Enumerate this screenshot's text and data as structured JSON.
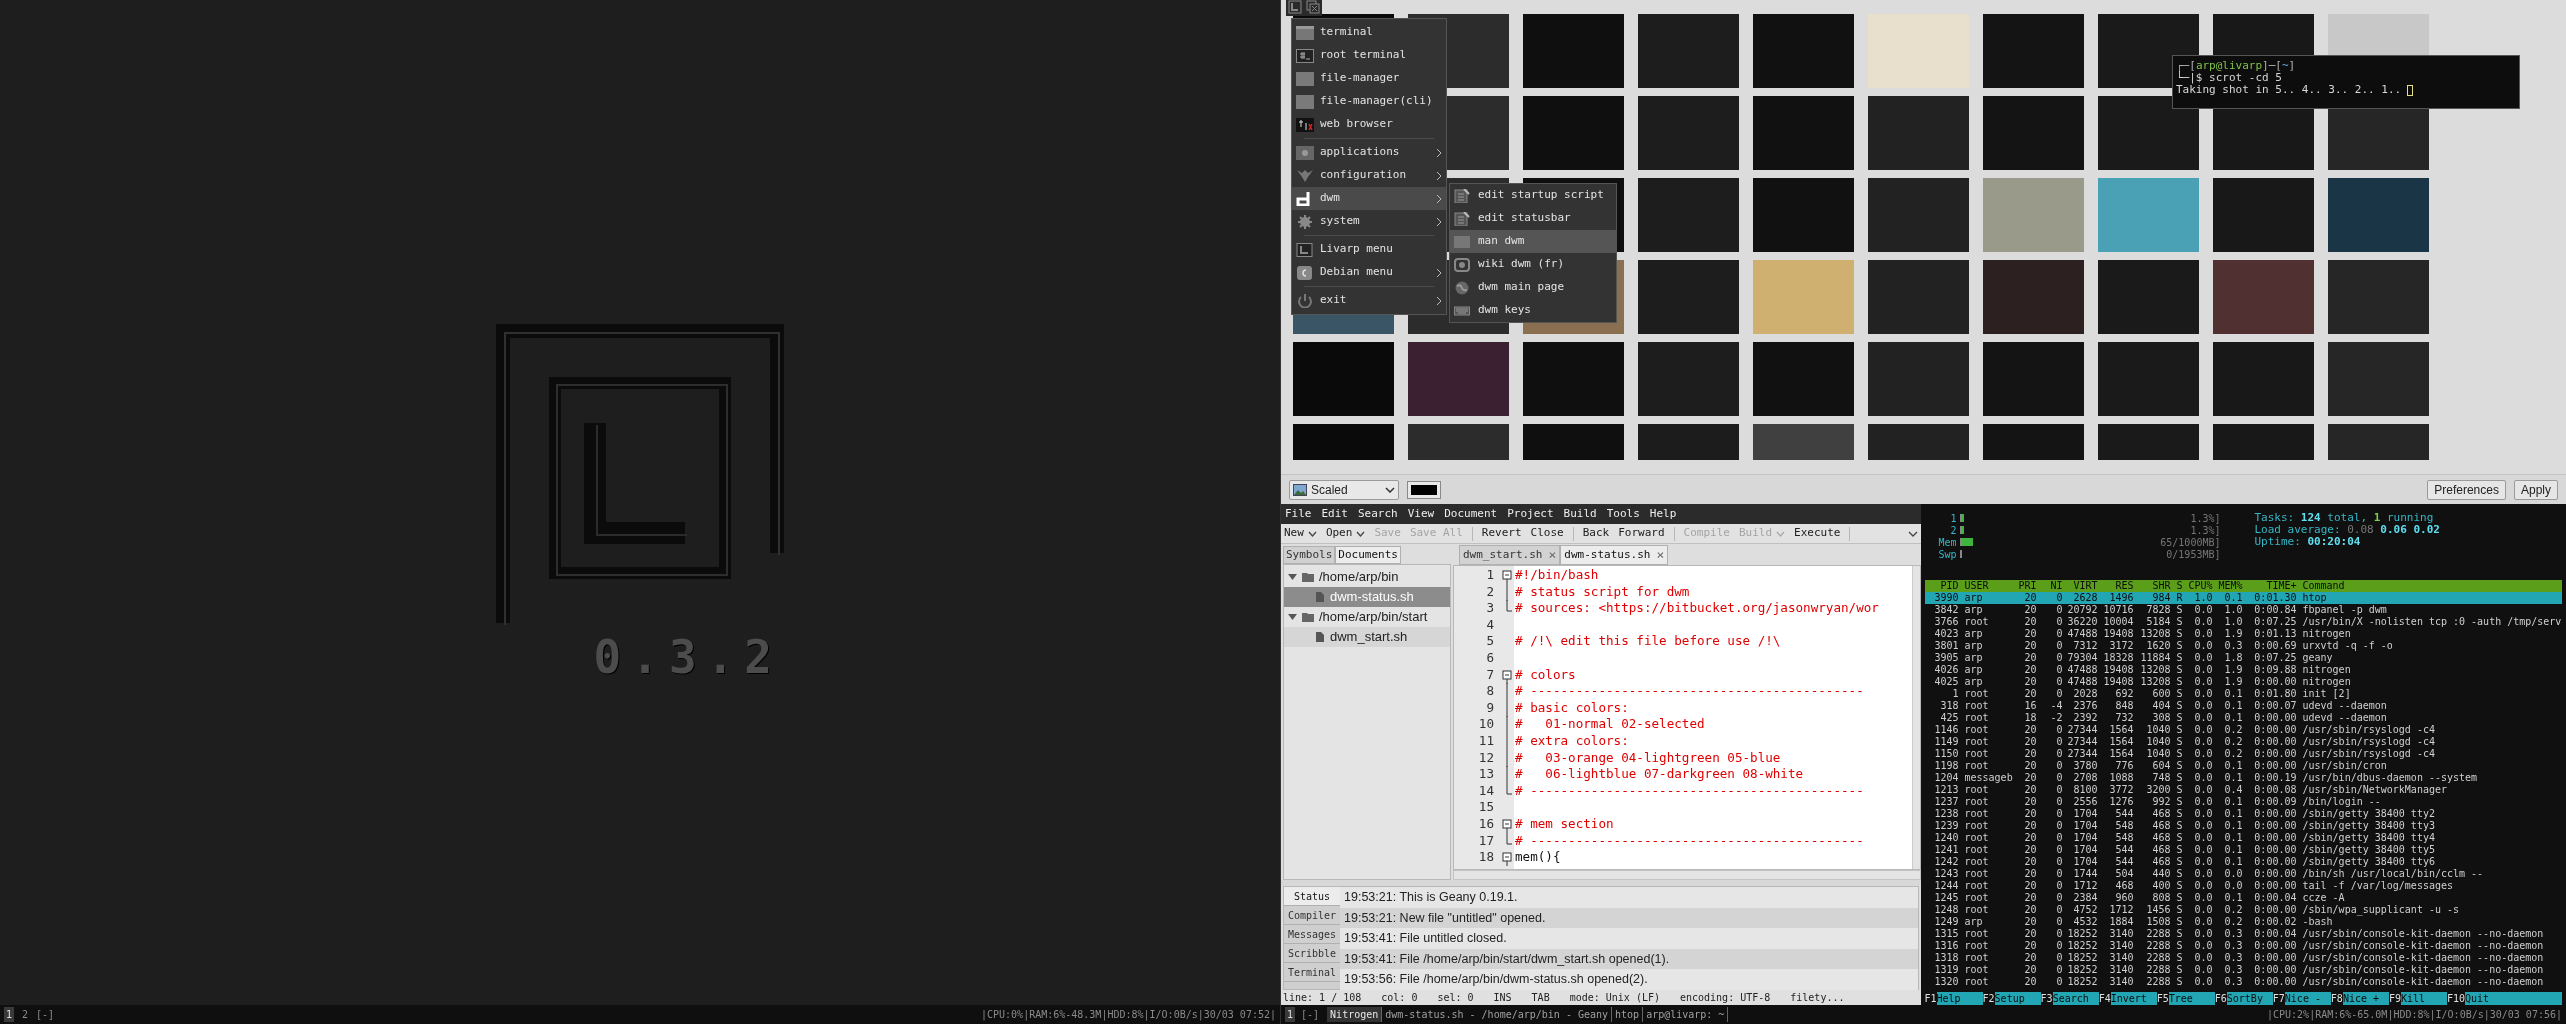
{
  "left_screen": {
    "logo_version": "0.3.2",
    "bar": {
      "tags": [
        {
          "label": "1",
          "selected": true
        },
        {
          "label": "2",
          "selected": false
        }
      ],
      "layout": "[-]",
      "status": "|CPU:0%|RAM:6%-48.3M|HDD:8%|I/O:0B/s|30/03 07:52|"
    }
  },
  "nitrogen": {
    "mode": "Scaled",
    "buttons": [
      "Preferences",
      "Apply"
    ]
  },
  "menu": {
    "items": [
      {
        "kind": "item",
        "label": "terminal",
        "has_submenu": false,
        "selected": false
      },
      {
        "kind": "item",
        "label": "root terminal",
        "has_submenu": false,
        "selected": false
      },
      {
        "kind": "item",
        "label": "file-manager",
        "has_submenu": false,
        "selected": false
      },
      {
        "kind": "item",
        "label": "file-manager(cli)",
        "has_submenu": false,
        "selected": false
      },
      {
        "kind": "item",
        "label": "web browser",
        "has_submenu": false,
        "selected": false
      },
      {
        "kind": "separator"
      },
      {
        "kind": "item",
        "label": "applications",
        "has_submenu": true,
        "selected": false
      },
      {
        "kind": "item",
        "label": "configuration",
        "has_submenu": true,
        "selected": false
      },
      {
        "kind": "item",
        "label": "dwm",
        "has_submenu": true,
        "selected": true,
        "submenu": [
          {
            "label": "edit startup script",
            "selected": false
          },
          {
            "label": "edit statusbar",
            "selected": false
          },
          {
            "label": "man dwm",
            "selected": true
          },
          {
            "label": "wiki dwm (fr)",
            "selected": false
          },
          {
            "label": "dwm main page",
            "selected": false
          },
          {
            "label": "dwm keys",
            "selected": false
          }
        ]
      },
      {
        "kind": "item",
        "label": "system",
        "has_submenu": true,
        "selected": false
      },
      {
        "kind": "separator"
      },
      {
        "kind": "item",
        "label": "Livarp menu",
        "has_submenu": false,
        "selected": false
      },
      {
        "kind": "item",
        "label": "Debian menu",
        "has_submenu": true,
        "selected": false
      },
      {
        "kind": "separator"
      },
      {
        "kind": "item",
        "label": "exit",
        "has_submenu": true,
        "selected": false
      }
    ]
  },
  "terminal": {
    "prompt": [
      {
        "text": "┌─[",
        "kind": "punct"
      },
      {
        "text": "arp@livarp",
        "kind": "user"
      },
      {
        "text": "]─[",
        "kind": "punct"
      },
      {
        "text": "~",
        "kind": "dir"
      },
      {
        "text": "]",
        "kind": "punct"
      }
    ],
    "command_line": "└─|$ scrot -cd 5",
    "output": "Taking shot in 5.. 4.. 3.. 2.. 1.."
  },
  "geany": {
    "menubar": [
      "File",
      "Edit",
      "Search",
      "View",
      "Document",
      "Project",
      "Build",
      "Tools",
      "Help"
    ],
    "toolbar": [
      {
        "kind": "button",
        "label": "New",
        "dropdown": true,
        "disabled": false
      },
      {
        "kind": "button",
        "label": "Open",
        "dropdown": true,
        "disabled": false
      },
      {
        "kind": "button",
        "label": "Save",
        "dropdown": false,
        "disabled": true
      },
      {
        "kind": "button",
        "label": "Save All",
        "dropdown": false,
        "disabled": true
      },
      {
        "kind": "separator"
      },
      {
        "kind": "button",
        "label": "Revert",
        "dropdown": false,
        "disabled": false
      },
      {
        "kind": "button",
        "label": "Close",
        "dropdown": false,
        "disabled": false
      },
      {
        "kind": "separator"
      },
      {
        "kind": "button",
        "label": "Back",
        "dropdown": false,
        "disabled": false
      },
      {
        "kind": "button",
        "label": "Forward",
        "dropdown": false,
        "disabled": false
      },
      {
        "kind": "separator"
      },
      {
        "kind": "button",
        "label": "Compile",
        "dropdown": false,
        "disabled": true
      },
      {
        "kind": "button",
        "label": "Build",
        "dropdown": true,
        "disabled": true
      },
      {
        "kind": "button",
        "label": "Execute",
        "dropdown": false,
        "disabled": false
      },
      {
        "kind": "separator"
      }
    ],
    "sidebar_tabs": [
      {
        "label": "Symbols",
        "selected": false
      },
      {
        "label": "Documents",
        "selected": true
      }
    ],
    "documents": [
      {
        "label": "/home/arp/bin",
        "expanded": true,
        "children": [
          {
            "label": "dwm-status.sh",
            "selected": true
          }
        ]
      },
      {
        "label": "/home/arp/bin/start",
        "expanded": true,
        "children": [
          {
            "label": "dwm_start.sh",
            "selected": false
          }
        ]
      }
    ],
    "editor_tabs": [
      {
        "label": "dwm_start.sh",
        "close": "×",
        "selected": false
      },
      {
        "label": "dwm-status.sh",
        "close": "×",
        "selected": true
      }
    ],
    "lines": [
      {
        "number": "1",
        "text": "#!/bin/bash",
        "kind": "comment",
        "fold_start": true
      },
      {
        "number": "2",
        "text": "# status script for dwm",
        "kind": "comment",
        "fold_line": true
      },
      {
        "number": "3",
        "text": "# sources: <https://bitbucket.org/jasonwryan/wor",
        "kind": "comment",
        "fold_end": true
      },
      {
        "number": "4"
      },
      {
        "number": "5",
        "text": "# /!\\ edit this file before use /!\\",
        "kind": "comment"
      },
      {
        "number": "6"
      },
      {
        "number": "7",
        "text": "# colors",
        "kind": "comment",
        "fold_start": true
      },
      {
        "number": "8",
        "text": "# --------------------------------------------",
        "kind": "comment",
        "fold_line": true
      },
      {
        "number": "9",
        "text": "# basic colors:",
        "kind": "comment",
        "fold_line": true
      },
      {
        "number": "10",
        "text": "#   01-normal 02-selected",
        "kind": "comment",
        "fold_line": true
      },
      {
        "number": "11",
        "text": "# extra colors:",
        "kind": "comment",
        "fold_line": true
      },
      {
        "number": "12",
        "text": "#   03-orange 04-lightgreen 05-blue",
        "kind": "comment",
        "fold_line": true
      },
      {
        "number": "13",
        "text": "#   06-lightblue 07-darkgreen 08-white",
        "kind": "comment",
        "fold_line": true
      },
      {
        "number": "14",
        "text": "# --------------------------------------------",
        "kind": "comment",
        "fold_end": true
      },
      {
        "number": "15"
      },
      {
        "number": "16",
        "text": "# mem section",
        "kind": "comment",
        "fold_start": true
      },
      {
        "number": "17",
        "text": "# --------------------------------------------",
        "kind": "comment",
        "fold_end": true
      },
      {
        "number": "18",
        "text": "mem(){",
        "kind": "code",
        "fold_start": true
      }
    ],
    "message_tabs": [
      {
        "label": "Status",
        "selected": true
      },
      {
        "label": "Compiler",
        "selected": false
      },
      {
        "label": "Messages",
        "selected": false
      },
      {
        "label": "Scribble",
        "selected": false
      },
      {
        "label": "Terminal",
        "selected": false
      }
    ],
    "messages": [
      "19:53:21: This is Geany 0.19.1.",
      "19:53:21: New file \"untitled\" opened.",
      "19:53:41: File untitled closed.",
      "19:53:41: File /home/arp/bin/start/dwm_start.sh opened(1).",
      "19:53:56: File /home/arp/bin/dwm-status.sh opened(2)."
    ],
    "status_bar": [
      "line: 1 / 108",
      "col: 0",
      "sel: 0",
      "INS",
      "TAB",
      "mode: Unix (LF)",
      "encoding: UTF-8",
      "filety..."
    ]
  },
  "htop": {
    "meters": [
      {
        "label": "1",
        "level": 0.013,
        "reading": "1.3%]"
      },
      {
        "label": "2",
        "level": 0.013,
        "reading": "1.3%]"
      },
      {
        "label": "Mem",
        "level": 0.065,
        "reading": "65/1000MB]"
      },
      {
        "label": "Swp",
        "level": 0,
        "reading": "0/1953MB]"
      }
    ],
    "summary": [
      [
        {
          "text": "Tasks: ",
          "kind": "label"
        },
        {
          "text": "124",
          "kind": "value"
        },
        {
          "text": " total, ",
          "kind": "label"
        },
        {
          "text": "1",
          "kind": "good"
        },
        {
          "text": " running",
          "kind": "label"
        }
      ],
      [
        {
          "text": "Load average: ",
          "kind": "label"
        },
        {
          "text": "0.08",
          "kind": "dim"
        },
        {
          "text": " 0.06 0.02",
          "kind": "value"
        }
      ],
      [
        {
          "text": "Uptime: ",
          "kind": "label"
        },
        {
          "text": "00:20:04",
          "kind": "value"
        }
      ]
    ],
    "columns": [
      "PID",
      "USER",
      "PRI",
      "NI",
      "VIRT",
      "RES",
      "SHR",
      "S",
      "CPU%",
      "MEM%",
      "TIME+",
      "Command"
    ],
    "rows": [
      {
        "cells": [
          "3990",
          "arp",
          "20",
          "0",
          "2628",
          "1496",
          "984",
          "R",
          "1.0",
          "0.1",
          "0:01.30",
          "htop"
        ],
        "selected": true
      },
      {
        "cells": [
          "3842",
          "arp",
          "20",
          "0",
          "20792",
          "10716",
          "7828",
          "S",
          "0.0",
          "1.0",
          "0:00.84",
          "fbpanel -p dwm"
        ],
        "selected": false
      },
      {
        "cells": [
          "3766",
          "root",
          "20",
          "0",
          "36220",
          "10004",
          "5184",
          "S",
          "0.0",
          "1.0",
          "0:07.25",
          "/usr/bin/X -nolisten tcp :0 -auth /tmp/serv"
        ],
        "selected": false
      },
      {
        "cells": [
          "4023",
          "arp",
          "20",
          "0",
          "47488",
          "19408",
          "13208",
          "S",
          "0.0",
          "1.9",
          "0:01.13",
          "nitrogen"
        ],
        "selected": false
      },
      {
        "cells": [
          "3801",
          "arp",
          "20",
          "0",
          "7312",
          "3172",
          "1620",
          "S",
          "0.0",
          "0.3",
          "0:00.69",
          "urxvtd -q -f -o"
        ],
        "selected": false
      },
      {
        "cells": [
          "3905",
          "arp",
          "20",
          "0",
          "79304",
          "18328",
          "11884",
          "S",
          "0.0",
          "1.8",
          "0:07.25",
          "geany"
        ],
        "selected": false
      },
      {
        "cells": [
          "4026",
          "arp",
          "20",
          "0",
          "47488",
          "19408",
          "13208",
          "S",
          "0.0",
          "1.9",
          "0:09.88",
          "nitrogen"
        ],
        "selected": false
      },
      {
        "cells": [
          "4025",
          "arp",
          "20",
          "0",
          "47488",
          "19408",
          "13208",
          "S",
          "0.0",
          "1.9",
          "0:00.00",
          "nitrogen"
        ],
        "selected": false
      },
      {
        "cells": [
          "1",
          "root",
          "20",
          "0",
          "2028",
          "692",
          "600",
          "S",
          "0.0",
          "0.1",
          "0:01.80",
          "init [2]"
        ],
        "selected": false
      },
      {
        "cells": [
          "318",
          "root",
          "16",
          "-4",
          "2376",
          "848",
          "404",
          "S",
          "0.0",
          "0.1",
          "0:00.07",
          "udevd --daemon"
        ],
        "selected": false
      },
      {
        "cells": [
          "425",
          "root",
          "18",
          "-2",
          "2392",
          "732",
          "308",
          "S",
          "0.0",
          "0.1",
          "0:00.00",
          "udevd --daemon"
        ],
        "selected": false
      },
      {
        "cells": [
          "1146",
          "root",
          "20",
          "0",
          "27344",
          "1564",
          "1040",
          "S",
          "0.0",
          "0.2",
          "0:00.00",
          "/usr/sbin/rsyslogd -c4"
        ],
        "selected": false
      },
      {
        "cells": [
          "1149",
          "root",
          "20",
          "0",
          "27344",
          "1564",
          "1040",
          "S",
          "0.0",
          "0.2",
          "0:00.00",
          "/usr/sbin/rsyslogd -c4"
        ],
        "selected": false
      },
      {
        "cells": [
          "1150",
          "root",
          "20",
          "0",
          "27344",
          "1564",
          "1040",
          "S",
          "0.0",
          "0.2",
          "0:00.00",
          "/usr/sbin/rsyslogd -c4"
        ],
        "selected": false
      },
      {
        "cells": [
          "1198",
          "root",
          "20",
          "0",
          "3780",
          "776",
          "604",
          "S",
          "0.0",
          "0.1",
          "0:00.00",
          "/usr/sbin/cron"
        ],
        "selected": false
      },
      {
        "cells": [
          "1204",
          "messageb",
          "20",
          "0",
          "2708",
          "1088",
          "748",
          "S",
          "0.0",
          "0.1",
          "0:00.19",
          "/usr/bin/dbus-daemon --system"
        ],
        "selected": false
      },
      {
        "cells": [
          "1213",
          "root",
          "20",
          "0",
          "8100",
          "3772",
          "3200",
          "S",
          "0.0",
          "0.4",
          "0:00.08",
          "/usr/sbin/NetworkManager"
        ],
        "selected": false
      },
      {
        "cells": [
          "1237",
          "root",
          "20",
          "0",
          "2556",
          "1276",
          "992",
          "S",
          "0.0",
          "0.1",
          "0:00.09",
          "/bin/login --"
        ],
        "selected": false
      },
      {
        "cells": [
          "1238",
          "root",
          "20",
          "0",
          "1704",
          "544",
          "468",
          "S",
          "0.0",
          "0.1",
          "0:00.00",
          "/sbin/getty 38400 tty2"
        ],
        "selected": false
      },
      {
        "cells": [
          "1239",
          "root",
          "20",
          "0",
          "1704",
          "548",
          "468",
          "S",
          "0.0",
          "0.1",
          "0:00.00",
          "/sbin/getty 38400 tty3"
        ],
        "selected": false
      },
      {
        "cells": [
          "1240",
          "root",
          "20",
          "0",
          "1704",
          "548",
          "468",
          "S",
          "0.0",
          "0.1",
          "0:00.00",
          "/sbin/getty 38400 tty4"
        ],
        "selected": false
      },
      {
        "cells": [
          "1241",
          "root",
          "20",
          "0",
          "1704",
          "544",
          "468",
          "S",
          "0.0",
          "0.1",
          "0:00.00",
          "/sbin/getty 38400 tty5"
        ],
        "selected": false
      },
      {
        "cells": [
          "1242",
          "root",
          "20",
          "0",
          "1704",
          "544",
          "468",
          "S",
          "0.0",
          "0.1",
          "0:00.00",
          "/sbin/getty 38400 tty6"
        ],
        "selected": false
      },
      {
        "cells": [
          "1243",
          "root",
          "20",
          "0",
          "1744",
          "504",
          "440",
          "S",
          "0.0",
          "0.0",
          "0:00.00",
          "/bin/sh /usr/local/bin/cclm --"
        ],
        "selected": false
      },
      {
        "cells": [
          "1244",
          "root",
          "20",
          "0",
          "1712",
          "468",
          "400",
          "S",
          "0.0",
          "0.0",
          "0:00.00",
          "tail -f /var/log/messages"
        ],
        "selected": false
      },
      {
        "cells": [
          "1245",
          "root",
          "20",
          "0",
          "2384",
          "960",
          "808",
          "S",
          "0.0",
          "0.1",
          "0:00.04",
          "ccze -A"
        ],
        "selected": false
      },
      {
        "cells": [
          "1248",
          "root",
          "20",
          "0",
          "4752",
          "1712",
          "1456",
          "S",
          "0.0",
          "0.2",
          "0:00.00",
          "/sbin/wpa_supplicant -u -s"
        ],
        "selected": false
      },
      {
        "cells": [
          "1249",
          "arp",
          "20",
          "0",
          "4532",
          "1884",
          "1508",
          "S",
          "0.0",
          "0.2",
          "0:00.02",
          "-bash"
        ],
        "selected": false
      },
      {
        "cells": [
          "1315",
          "root",
          "20",
          "0",
          "18252",
          "3140",
          "2288",
          "S",
          "0.0",
          "0.3",
          "0:00.04",
          "/usr/sbin/console-kit-daemon --no-daemon"
        ],
        "selected": false
      },
      {
        "cells": [
          "1316",
          "root",
          "20",
          "0",
          "18252",
          "3140",
          "2288",
          "S",
          "0.0",
          "0.3",
          "0:00.00",
          "/usr/sbin/console-kit-daemon --no-daemon"
        ],
        "selected": false
      },
      {
        "cells": [
          "1318",
          "root",
          "20",
          "0",
          "18252",
          "3140",
          "2288",
          "S",
          "0.0",
          "0.3",
          "0:00.00",
          "/usr/sbin/console-kit-daemon --no-daemon"
        ],
        "selected": false
      },
      {
        "cells": [
          "1319",
          "root",
          "20",
          "0",
          "18252",
          "3140",
          "2288",
          "S",
          "0.0",
          "0.3",
          "0:00.00",
          "/usr/sbin/console-kit-daemon --no-daemon"
        ],
        "selected": false
      },
      {
        "cells": [
          "1320",
          "root",
          "20",
          "0",
          "18252",
          "3140",
          "2288",
          "S",
          "0.0",
          "0.3",
          "0:00.00",
          "/usr/sbin/console-kit-daemon --no-daemon"
        ],
        "selected": false
      }
    ],
    "function_keys": [
      {
        "key": "F1",
        "label": "Help"
      },
      {
        "key": "F2",
        "label": "Setup"
      },
      {
        "key": "F3",
        "label": "Search"
      },
      {
        "key": "F4",
        "label": "Invert"
      },
      {
        "key": "F5",
        "label": "Tree"
      },
      {
        "key": "F6",
        "label": "SortBy"
      },
      {
        "key": "F7",
        "label": "Nice -"
      },
      {
        "key": "F8",
        "label": "Nice +"
      },
      {
        "key": "F9",
        "label": "Kill"
      },
      {
        "key": "F10",
        "label": "Quit"
      }
    ]
  },
  "right_bar": {
    "tags": [
      {
        "label": "1",
        "selected": true
      }
    ],
    "layout": "[-]",
    "tasks": [
      {
        "label": "Nitrogen",
        "selected": true
      },
      {
        "label": "dwm-status.sh - /home/arp/bin - Geany",
        "selected": false
      },
      {
        "label": "htop",
        "selected": false
      },
      {
        "label": "arp@livarp: ~",
        "selected": false
      }
    ],
    "status": "|CPU:2%|RAM:6%-65.0M|HDD:8%|I/O:0B/s|30/03 07:56|"
  }
}
